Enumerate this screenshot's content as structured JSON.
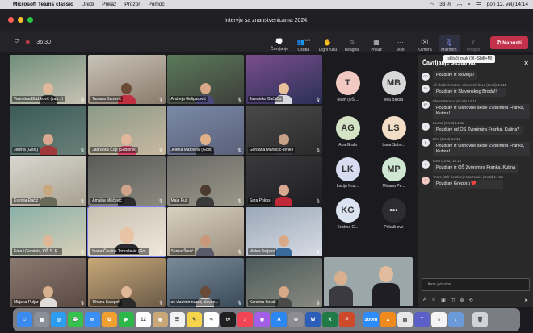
{
  "menubar": {
    "app": "Microsoft Teams classic",
    "items": [
      "Uredi",
      "Prikaz",
      "Prozor",
      "Pomoć"
    ],
    "battery": "33 %",
    "datetime": "pon 12. velj 14:14"
  },
  "window": {
    "title": "Intervju sa znanstvenicama 2024."
  },
  "toolbar": {
    "timer": "36:30",
    "buttons": [
      {
        "label": "Čavrljanje",
        "icon": "chat-icon"
      },
      {
        "label": "Osoba",
        "icon": "people-icon",
        "count": "149"
      },
      {
        "label": "Digni ruku",
        "icon": "raise-hand-icon"
      },
      {
        "label": "Reagiraj",
        "icon": "react-icon"
      },
      {
        "label": "Prikaz",
        "icon": "view-icon"
      },
      {
        "label": "Više",
        "icon": "more-icon"
      },
      {
        "label": "Kamera",
        "icon": "camera-off-icon"
      },
      {
        "label": "Mikrofon",
        "icon": "mic-icon"
      },
      {
        "label": "Podijeli",
        "icon": "share-icon"
      }
    ],
    "leave": "Napusti"
  },
  "tooltip": "Isključi zvuk (⌘+Shift+M)",
  "tiles": [
    {
      "name": "Valentina Blažiković (van...)"
    },
    {
      "name": "Tamara Banović"
    },
    {
      "name": "Andreja Galiparović"
    },
    {
      "name": "Jasminka Bačeča"
    },
    {
      "name": "Jelena (Gost)"
    },
    {
      "name": "Jadranka Čop (Sudionik)"
    },
    {
      "name": "Jelena Matovina (Gost)"
    },
    {
      "name": "Gordana Marinčić-Jeneš"
    },
    {
      "name": "Ksenija Đačić"
    },
    {
      "name": "Amalija Miličević"
    },
    {
      "name": "Maja Puš"
    },
    {
      "name": "Sara Pokos"
    },
    {
      "name": "Ema i Gabriela, OŠ S. R..."
    },
    {
      "name": "Ivana Čavlina Tomašević (Go..."
    },
    {
      "name": "Senka Štetić"
    },
    {
      "name": "Matea Jurjako"
    },
    {
      "name": "Mirjana Puljar"
    },
    {
      "name": "Tihana Salopek"
    },
    {
      "name": "oš vladimir nazor, slavon..."
    },
    {
      "name": "Karolina Borak"
    }
  ],
  "roster": [
    {
      "initials": "T",
      "name": "Team (OŠ ...",
      "color": "#f1c8c2"
    },
    {
      "initials": "MB",
      "name": "Mia Baksa",
      "color": "#d8d8d8"
    },
    {
      "initials": "AG",
      "name": "Ana Grala",
      "color": "#d3e3c3"
    },
    {
      "initials": "LS",
      "name": "Lana Sabo...",
      "color": "#f2dec6"
    },
    {
      "initials": "LK",
      "name": "Lucija Kraj...",
      "color": "#d8dcf0"
    },
    {
      "initials": "MP",
      "name": "Mirjana Pe...",
      "color": "#cfe6d2"
    },
    {
      "initials": "KG",
      "name": "Kristina G...",
      "color": "#dbe3f0"
    },
    {
      "initials": "•••",
      "name": "Prikaži sve",
      "color": "#2d2d31"
    }
  ],
  "chat": {
    "title": "Čavrljanje sastanka",
    "messages": [
      {
        "initials": "OD",
        "meta": "",
        "text": "Pozdrav iz Rovinja!"
      },
      {
        "initials": "SN",
        "meta": "oš vladimir nazor, slavonski brod (Gost) 14:11",
        "text": "Pozdrav iz Slavonskog Broda!!"
      },
      {
        "initials": "EP",
        "meta": "Elena Penava (Gost) 14:11",
        "text": "Pozdrav iz Osnovne škole Zvonimira Franka, Kutina!"
      },
      {
        "initials": "L",
        "meta": "Leona (Gost) 14:12",
        "text": "Pozdrav od OŠ Zvonimira Franka, Kutina?"
      },
      {
        "initials": "E",
        "meta": "Emi (Gost) 14:12",
        "text": "Pozdrav iz Osnovne škole Zvonimira Franka, Kutina!"
      },
      {
        "initials": "L",
        "meta": "Lora (Gost) 14:12",
        "text": "Pozdrav iz OŠ Zvonimira Franka, Kutina"
      },
      {
        "initials": "T",
        "meta": "Team (OŠ Šestine|Anita Kanić (Gost) 14:13",
        "text": "Pozdrav Gregoru ❤️"
      }
    ],
    "compose_placeholder": "Unos poruke"
  },
  "dock": [
    {
      "name": "finder-icon",
      "color": "#3b8af0",
      "label": "☺"
    },
    {
      "name": "launchpad-icon",
      "color": "#8a8f99",
      "label": "▦"
    },
    {
      "name": "safari-icon",
      "color": "#2b9cf0",
      "label": "◎"
    },
    {
      "name": "messages-icon",
      "color": "#35c34e",
      "label": "💬"
    },
    {
      "name": "mail-icon",
      "color": "#3a8ff5",
      "label": "✉"
    },
    {
      "name": "photos-icon",
      "color": "#f0a030",
      "label": "✿"
    },
    {
      "name": "facetime-icon",
      "color": "#2fb84a",
      "label": "▶"
    },
    {
      "name": "calendar-icon",
      "color": "#ffffff",
      "label": "12"
    },
    {
      "name": "contacts-icon",
      "color": "#c8a878",
      "label": "◉"
    },
    {
      "name": "reminders-icon",
      "color": "#f2f2f2",
      "label": "☰"
    },
    {
      "name": "notes-icon",
      "color": "#f5d34a",
      "label": "✎"
    },
    {
      "name": "freeform-icon",
      "color": "#ffffff",
      "label": "∿"
    },
    {
      "name": "tv-icon",
      "color": "#202020",
      "label": "tv"
    },
    {
      "name": "music-icon",
      "color": "#f14556",
      "label": "♫"
    },
    {
      "name": "podcasts-icon",
      "color": "#a35ee8",
      "label": "◉"
    },
    {
      "name": "appstore-icon",
      "color": "#2b88f2",
      "label": "A"
    },
    {
      "name": "settings-icon",
      "color": "#8c8c92",
      "label": "⚙"
    },
    {
      "name": "word-icon",
      "color": "#2b5eb8",
      "label": "W"
    },
    {
      "name": "excel-icon",
      "color": "#1f7a45",
      "label": "X"
    },
    {
      "name": "powerpoint-icon",
      "color": "#cc4a2a",
      "label": "P"
    },
    {
      "name": "zoom-icon",
      "color": "#2d8cff",
      "label": "zoom"
    },
    {
      "name": "vlc-icon",
      "color": "#f08a1c",
      "label": "▲"
    },
    {
      "name": "preview-icon",
      "color": "#e8e8e8",
      "label": "▤"
    },
    {
      "name": "teams-icon",
      "color": "#5b5fc7",
      "label": "T"
    },
    {
      "name": "document-icon",
      "color": "#f4f4f4",
      "label": "≡"
    },
    {
      "name": "downloads-icon",
      "color": "#6a9ad8",
      "label": "↓"
    },
    {
      "name": "trash-icon",
      "color": "#d0d4da",
      "label": "🗑"
    }
  ]
}
